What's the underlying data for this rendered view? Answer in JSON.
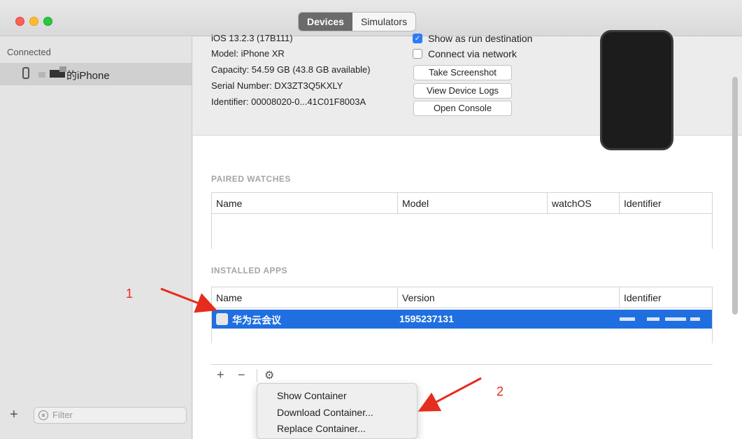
{
  "toolbar": {
    "tabs": [
      {
        "label": "Devices"
      },
      {
        "label": "Simulators"
      }
    ]
  },
  "sidebar": {
    "heading": "Connected",
    "device_name": "的iPhone",
    "filter_placeholder": "Filter"
  },
  "device_info": {
    "lines": [
      "iOS 13.2.3 (17B111)",
      "Model: iPhone XR",
      "Capacity: 54.59 GB (43.8 GB available)",
      "Serial Number: DX3ZT3Q5KXLY",
      "Identifier: 00008020-0...41C01F8003A"
    ],
    "show_run_destination": "Show as run destination",
    "connect_network": "Connect via network",
    "buttons": [
      "Take Screenshot",
      "View Device Logs",
      "Open Console"
    ]
  },
  "paired_watches": {
    "title": "PAIRED WATCHES",
    "columns": [
      "Name",
      "Model",
      "watchOS",
      "Identifier"
    ]
  },
  "installed_apps": {
    "title": "INSTALLED APPS",
    "columns": [
      "Name",
      "Version",
      "Identifier"
    ],
    "rows": [
      {
        "name": "华为云会议",
        "version": "1595237131"
      }
    ]
  },
  "list_toolbar": {
    "plus": "+",
    "minus": "−",
    "gear": "⚙"
  },
  "context_menu": {
    "items": [
      "Show Container",
      "Download Container...",
      "Replace Container..."
    ]
  },
  "annotations": [
    "1",
    "2"
  ],
  "colors": {
    "selection": "#1f6fe0",
    "annotation_red": "#e52d1f"
  }
}
